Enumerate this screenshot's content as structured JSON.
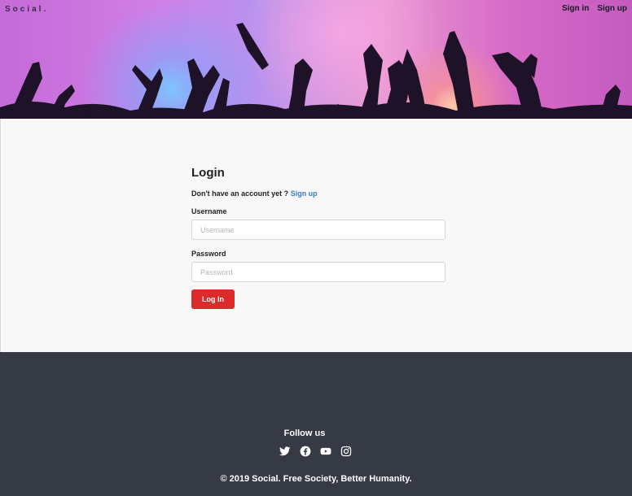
{
  "header": {
    "brand": "Social.",
    "nav": {
      "signin": "Sign in",
      "signup": "Sign up"
    }
  },
  "login": {
    "title": "Login",
    "no_account_text": "Don't have an account yet ?",
    "signup_link": "Sign up",
    "username_label": "Username",
    "username_placeholder": "Username",
    "password_label": "Password",
    "password_placeholder": "Password",
    "submit_label": "Log In"
  },
  "footer": {
    "follow_title": "Follow us",
    "socials": [
      "twitter-icon",
      "facebook-icon",
      "youtube-icon",
      "instagram-icon"
    ],
    "copyright": "© 2019 Social. Free Society, Better Humanity."
  },
  "colors": {
    "accent": "#dc2b2b",
    "link": "#3b7bbf",
    "footer_bg": "#363a45"
  }
}
